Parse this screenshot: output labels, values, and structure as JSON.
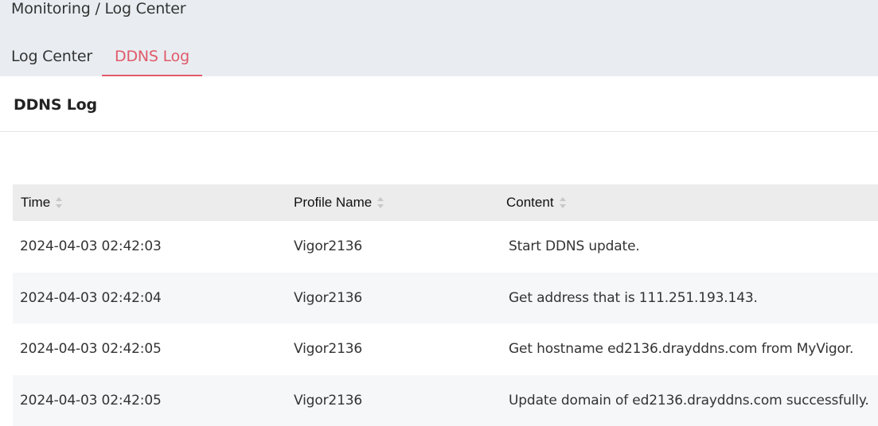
{
  "header": {
    "breadcrumb": "Monitoring / Log Center",
    "tabs": [
      {
        "label": "Log Center",
        "active": false
      },
      {
        "label": "DDNS Log",
        "active": true
      }
    ]
  },
  "panel": {
    "title": "DDNS Log"
  },
  "table": {
    "columns": [
      "Time",
      "Profile Name",
      "Content"
    ],
    "rows": [
      {
        "time": "2024-04-03 02:42:03",
        "profile": "Vigor2136",
        "content": "Start DDNS update."
      },
      {
        "time": "2024-04-03 02:42:04",
        "profile": "Vigor2136",
        "content": "Get address that is 111.251.193.143."
      },
      {
        "time": "2024-04-03 02:42:05",
        "profile": "Vigor2136",
        "content": "Get hostname ed2136.drayddns.com from MyVigor."
      },
      {
        "time": "2024-04-03 02:42:05",
        "profile": "Vigor2136",
        "content": "Update domain of ed2136.drayddns.com successfully."
      }
    ]
  },
  "colors": {
    "accent": "#e05a6a",
    "header_bg": "#e9edf1",
    "table_header_bg": "#ececec",
    "row_alt_bg": "#f5f7f9"
  }
}
